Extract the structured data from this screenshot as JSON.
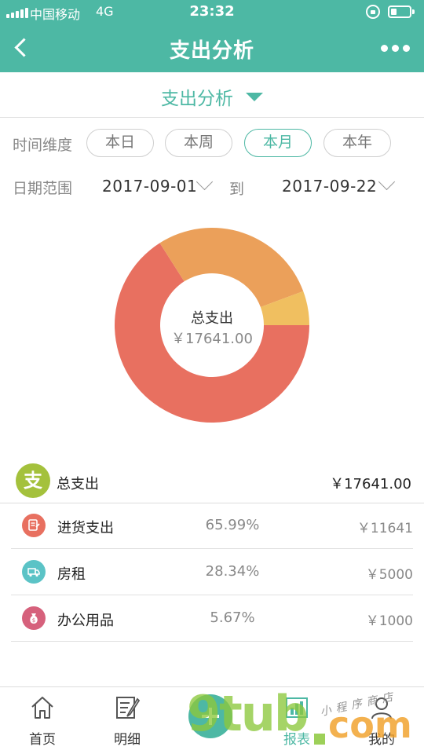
{
  "status_bar": {
    "carrier": "中国移动",
    "network": "4G",
    "time": "23:32",
    "battery_level": 0.3
  },
  "nav": {
    "title": "支出分析",
    "back_icon": "chevron-left-icon",
    "more_icon": "more-dots-icon"
  },
  "selector": {
    "label": "支出分析"
  },
  "time_dimension": {
    "label": "时间维度",
    "options": [
      "本日",
      "本周",
      "本月",
      "本年"
    ],
    "selected": "本月"
  },
  "date_range": {
    "label": "日期范围",
    "start": "2017-09-01",
    "to_label": "到",
    "end": "2017-09-22"
  },
  "chart_data": {
    "type": "pie",
    "center_title": "总支出",
    "center_value": "￥17641.00",
    "slices": [
      {
        "name": "进货支出",
        "percent": 65.99,
        "value": 11641,
        "color": "#e87060"
      },
      {
        "name": "房租",
        "percent": 28.34,
        "value": 5000,
        "color": "#eba05a"
      },
      {
        "name": "办公用品",
        "percent": 5.67,
        "value": 1000,
        "color": "#f0bf60"
      }
    ]
  },
  "summary": {
    "badge": "支",
    "badge_color": "#a4c13c",
    "total_label": "总支出",
    "total_amount": "￥17641.00",
    "items": [
      {
        "name": "进货支出",
        "percent": "65.99%",
        "amount": "￥11641",
        "icon": "invoice-icon",
        "icon_color": "#e87060"
      },
      {
        "name": "房租",
        "percent": "28.34%",
        "amount": "￥5000",
        "icon": "truck-icon",
        "icon_color": "#5bc3c6"
      },
      {
        "name": "办公用品",
        "percent": "5.67%",
        "amount": "￥1000",
        "icon": "money-bag-icon",
        "icon_color": "#d6617c"
      }
    ]
  },
  "tabbar": {
    "tabs": [
      {
        "label": "首页",
        "icon": "home-icon"
      },
      {
        "label": "明细",
        "icon": "edit-list-icon"
      },
      {
        "label": "",
        "icon": "plus-icon"
      },
      {
        "label": "报表",
        "icon": "chart-icon"
      },
      {
        "label": "我的",
        "icon": "user-icon"
      }
    ]
  },
  "watermark": {
    "text": "9tub",
    "suffix": "com",
    "script": "小程序商店"
  },
  "colors": {
    "primary": "#4db8a4"
  }
}
